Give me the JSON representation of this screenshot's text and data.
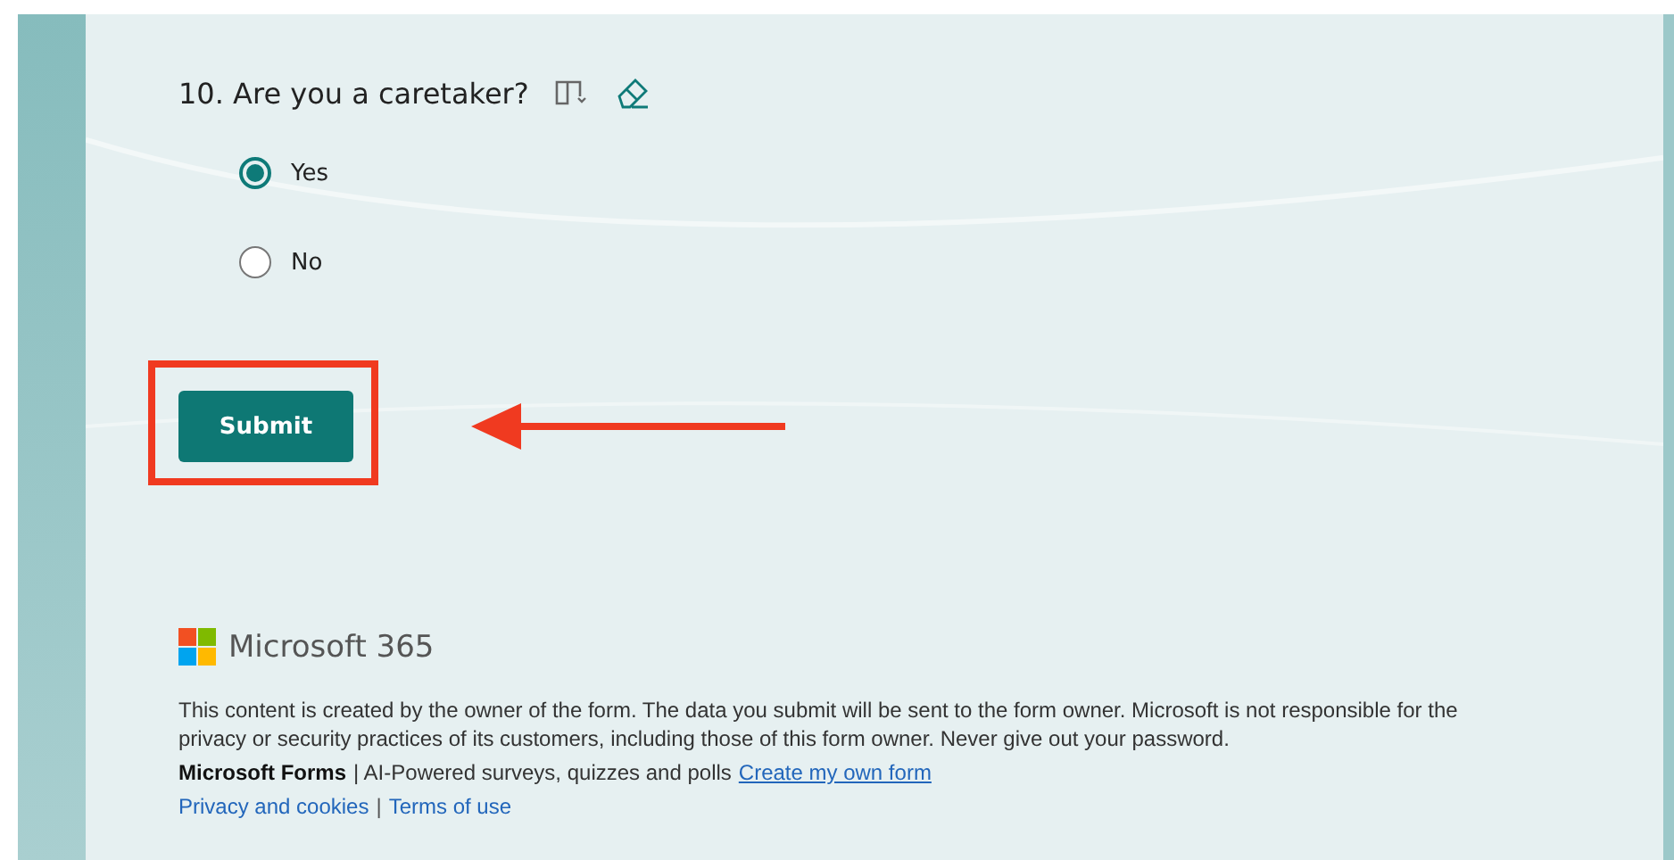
{
  "question": {
    "number": "10.",
    "text": "Are you a caretaker?"
  },
  "options": [
    {
      "label": "Yes",
      "selected": true
    },
    {
      "label": "No",
      "selected": false
    }
  ],
  "submit_button": "Submit",
  "footer": {
    "brand": "Microsoft 365",
    "disclaimer": "This content is created by the owner of the form. The data you submit will be sent to the form owner. Microsoft is not responsible for the privacy or security practices of its customers, including those of this form owner. Never give out your password.",
    "product": "Microsoft Forms",
    "tagline": "| AI-Powered surveys, quizzes and polls",
    "create_link": "Create my own form",
    "links": [
      {
        "label": "Privacy and cookies"
      },
      {
        "label": "Terms of use"
      }
    ],
    "link_separator": "|"
  }
}
